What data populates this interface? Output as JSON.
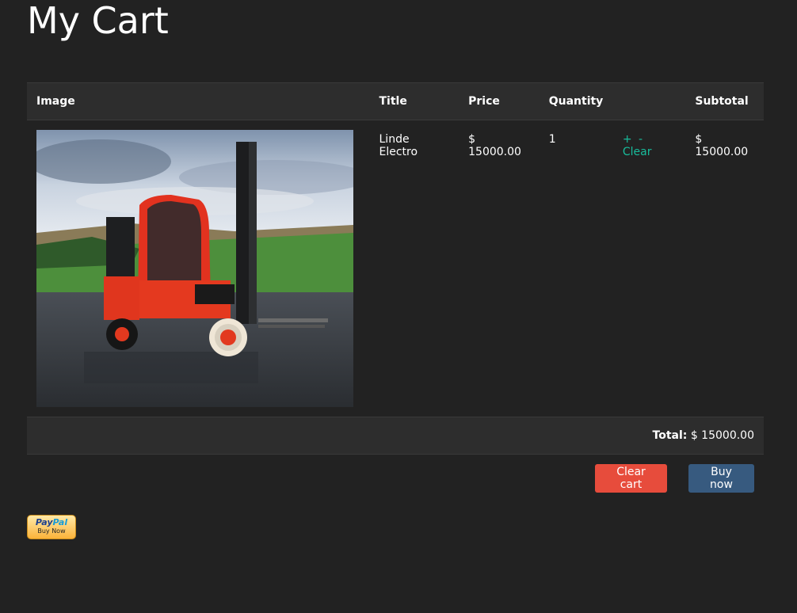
{
  "page": {
    "title": "My Cart"
  },
  "table": {
    "headers": {
      "image": "Image",
      "title": "Title",
      "price": "Price",
      "quantity": "Quantity",
      "actions": "",
      "subtotal": "Subtotal"
    },
    "rows": [
      {
        "image_alt": "forklift-photo",
        "title": "Linde Electro",
        "price": "$ 15000.00",
        "quantity": "1",
        "increase_label": "+",
        "decrease_label": "-",
        "clear_label": "Clear",
        "subtotal": "$ 15000.00"
      }
    ],
    "total_label": "Total:",
    "total_value": "$ 15000.00"
  },
  "buttons": {
    "clear_cart": "Clear cart",
    "buy_now": "Buy now"
  },
  "paypal": {
    "logo_pay": "Pay",
    "logo_pal": "Pal",
    "sub_label": "Buy Now"
  },
  "colors": {
    "background": "#222222",
    "accent_link": "#18bc9c",
    "danger": "#e74c3c",
    "primary": "#375a7f"
  }
}
